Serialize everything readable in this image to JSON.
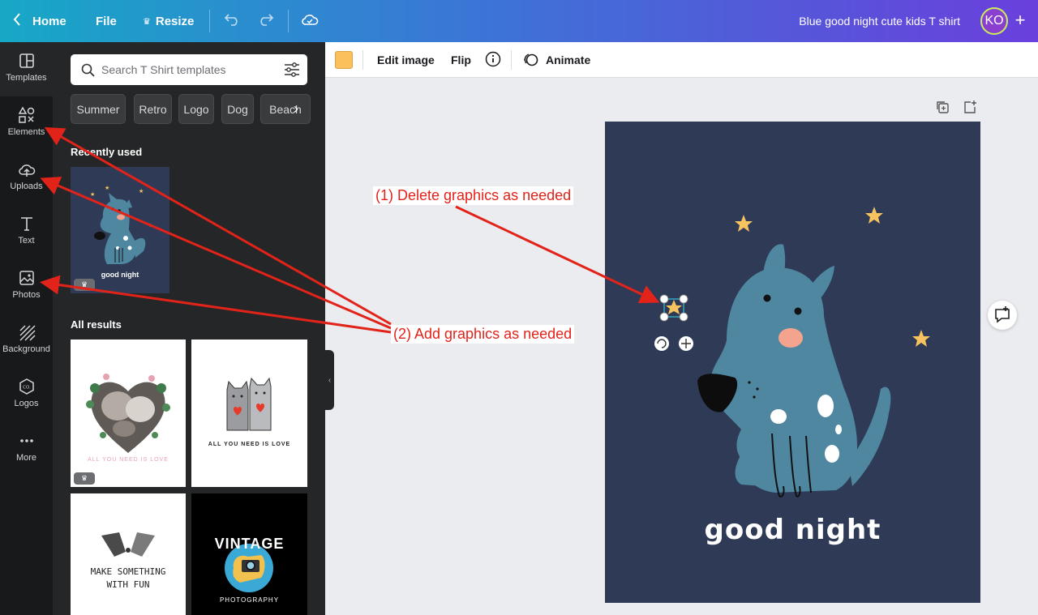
{
  "topbar": {
    "home_label": "Home",
    "file_label": "File",
    "resize_label": "Resize",
    "doc_title": "Blue good night cute kids T shirt",
    "avatar_initials": "KO"
  },
  "rail": {
    "items": [
      {
        "label": "Templates",
        "icon": "templates-icon"
      },
      {
        "label": "Elements",
        "icon": "elements-icon"
      },
      {
        "label": "Uploads",
        "icon": "uploads-icon"
      },
      {
        "label": "Text",
        "icon": "text-icon"
      },
      {
        "label": "Photos",
        "icon": "photos-icon"
      },
      {
        "label": "Background",
        "icon": "background-icon"
      },
      {
        "label": "Logos",
        "icon": "logos-icon"
      },
      {
        "label": "More",
        "icon": "more-icon"
      }
    ]
  },
  "panel": {
    "search_placeholder": "Search T Shirt templates",
    "chips": [
      "Summer",
      "Retro",
      "Logo",
      "Dog",
      "Beach"
    ],
    "recently_used": "Recently used",
    "all_results": "All results",
    "thumbs": {
      "recent_caption": "good night",
      "love_caption": "ALL YOU NEED IS LOVE",
      "make_caption_1": "MAKE SOMETHING",
      "make_caption_2": "WITH FUN",
      "vintage_title": "VINTAGE",
      "vintage_sub": "PHOTOGRAPHY"
    }
  },
  "toolbar": {
    "color_swatch": "#fbbf5c",
    "edit_image": "Edit image",
    "flip": "Flip",
    "animate": "Animate"
  },
  "design": {
    "caption": "good night",
    "background_color": "#2e3a56",
    "dog_color": "#4f87a0",
    "star_color": "#f6c35f"
  },
  "annotations": {
    "delete_note": "(1) Delete graphics as needed",
    "add_note": "(2) Add graphics as needed",
    "arrow_color": "#e2231a"
  }
}
